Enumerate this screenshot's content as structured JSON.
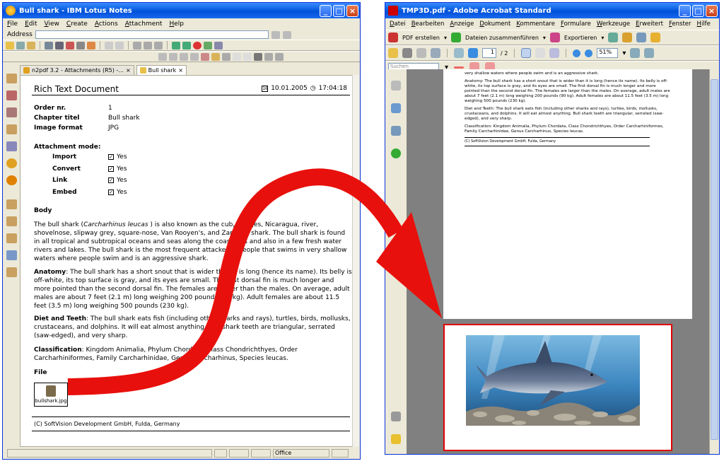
{
  "notes": {
    "title": "Bull shark - IBM Lotus Notes",
    "menu": [
      "File",
      "Edit",
      "View",
      "Create",
      "Actions",
      "Attachment",
      "Help"
    ],
    "address_label": "Address",
    "tabs": [
      "n2pdf 3.2 - Attachments (R5) -...",
      "Bull shark"
    ],
    "doc": {
      "title": "Rich Text Document",
      "date": "10.01.2005",
      "time": "17:04:18",
      "fields": [
        {
          "label": "Order nr.",
          "value": "1"
        },
        {
          "label": "Chapter titel",
          "value": "Bull shark"
        },
        {
          "label": "Image format",
          "value": "JPG"
        }
      ],
      "attachment_heading": "Attachment mode:",
      "modes": [
        {
          "label": "Import",
          "value": "Yes"
        },
        {
          "label": "Convert",
          "value": "Yes"
        },
        {
          "label": "Link",
          "value": "Yes"
        },
        {
          "label": "Embed",
          "value": "Yes"
        }
      ],
      "body_heading": "Body",
      "body_p1a": "The bull shark (",
      "body_p1_italic": "Carcharhinus leucas",
      "body_p1b": ") is also known as the cub, Ganges, Nicaragua, river, shovelnose, slipway grey, square-nose, Van Rooyen's, and Zambezi shark. The bull shark is found in all tropical and subtropical oceans and seas along the coastlines and also in a few fresh water rivers and lakes. The bull shark is the most frequent attacker of people that swims in very shallow waters where people swim and is an aggressive shark.",
      "anatomy_label": "Anatomy",
      "anatomy_text": ": The bull shark has a short snout that is wider than it is long (hence its name). Its belly is off-white, its top surface is gray, and its eyes are small. The first dorsal fin is much longer and more pointed than the second dorsal fin. The females are larger than the males. On average, adult males are about 7 feet (2.1 m) long weighing 200 pounds (90 kg). Adult females are about 11.5 feet (3.5 m) long weighing 500 pounds (230 kg).",
      "diet_label": "Diet and Teeth",
      "diet_text": ": The bull shark eats fish (including other sharks and rays), turtles, birds, mollusks, crustaceans, and dolphins. It will eat almost anything. Bull shark teeth are triangular, serrated (saw-edged), and very sharp.",
      "class_label": "Classification",
      "class_text": ": Kingdom Animalia, Phylum Chordata, Class Chondrichthyes, Order Carcharhiniformes, Family Carcharhinidae, Genus Carcharhinus, Species leucas.",
      "file_heading": "File",
      "file_name": "bullshark.jpg",
      "footer": "(C) SoftVision Development GmbH, Fulda, Germany"
    },
    "status_office": "Office"
  },
  "acro": {
    "title": "TMP3D.pdf - Adobe Acrobat Standard",
    "menu": [
      "Datei",
      "Bearbeiten",
      "Anzeige",
      "Dokument",
      "Kommentare",
      "Formulare",
      "Werkzeuge",
      "Erweitert",
      "Fenster",
      "Hilfe"
    ],
    "pdf_create": "PDF erstellen",
    "merge": "Dateien zusammenführen",
    "export": "Exportieren",
    "page_current": "1",
    "page_total": "/ 2",
    "zoom": "51%",
    "search_placeholder": "Suchen",
    "page_text_top": "very shallow waters where people swim and is an aggressive shark.",
    "page_anatomy": "Anatomy: The bull shark has a short snout that is wider than it is long (hence its name). Its belly is off-white, its top surface is gray, and its eyes are small. The first dorsal fin is much longer and more pointed than the second dorsal fin. The females are larger than the males. On average, adult males are about 7 feet (2.1 m) long weighing 200 pounds (90 kg). Adult females are about 11.5 feet (3.5 m) long weighing 500 pounds (230 kg).",
    "page_diet": "Diet and Teeth: The bull shark eats fish (including other sharks and rays), turtles, birds, mollusks, crustaceans, and dolphins. It will eat almost anything. Bull shark teeth are triangular, serrated (saw-edged), and very sharp.",
    "page_class": "Classification: Kingdom Animalia, Phylum Chordata, Class Chondrichthyes, Order Carcharhiniformes, Family Carcharhinidae, Genus Carcharhinus, Species leucas.",
    "page_footer": "(C) SoftVision Development GmbH, Fulda, Germany"
  },
  "colors": {
    "arrow": "#e8100c",
    "highlight": "#e00000",
    "titlebar": "#0a5fe0"
  }
}
